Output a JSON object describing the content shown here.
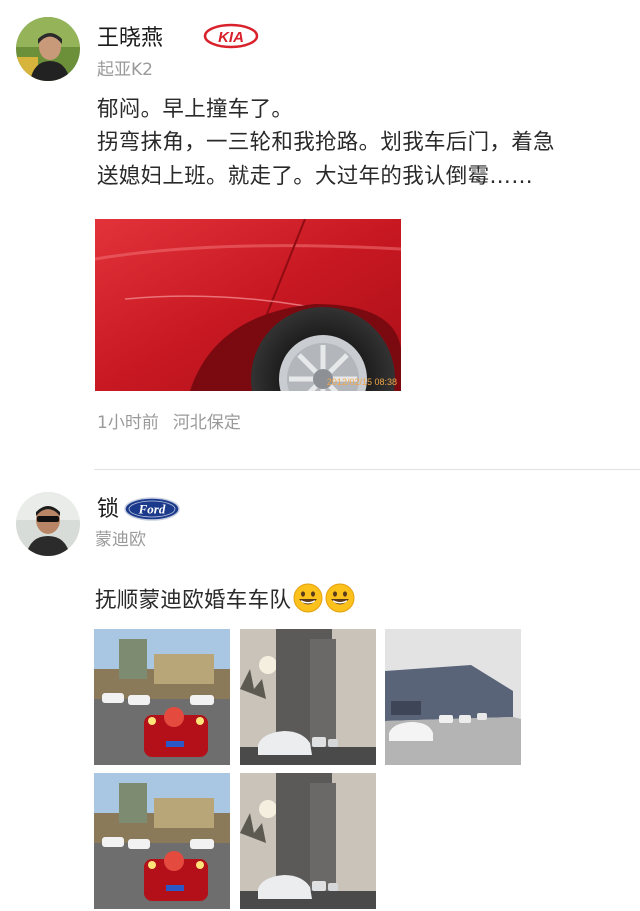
{
  "posts": [
    {
      "user_name": "王晓燕",
      "brand_logo": "kia-logo",
      "brand_text": "KIA",
      "car_model": "起亚K2",
      "text_lines": [
        "郁闷。早上撞车了。",
        "拐弯抹角，一三轮和我抢路。划我车后门，着急",
        "送媳妇上班。就走了。大过年的我认倒霉……"
      ],
      "photo_timestamp": "2012/02/15 08:38",
      "time_ago": "1小时前",
      "location": "河北保定"
    },
    {
      "user_name": "锁",
      "brand_logo": "ford-logo",
      "brand_text": "Ford",
      "car_model": "蒙迪欧",
      "text": "抚顺蒙迪欧婚车车队",
      "emojis": [
        "grinning-face-emoji",
        "grinning-face-emoji"
      ]
    }
  ],
  "colors": {
    "kia_red": "#d9212b",
    "ford_blue": "#1b3a8c",
    "secondary_text": "#9a9a9a"
  }
}
